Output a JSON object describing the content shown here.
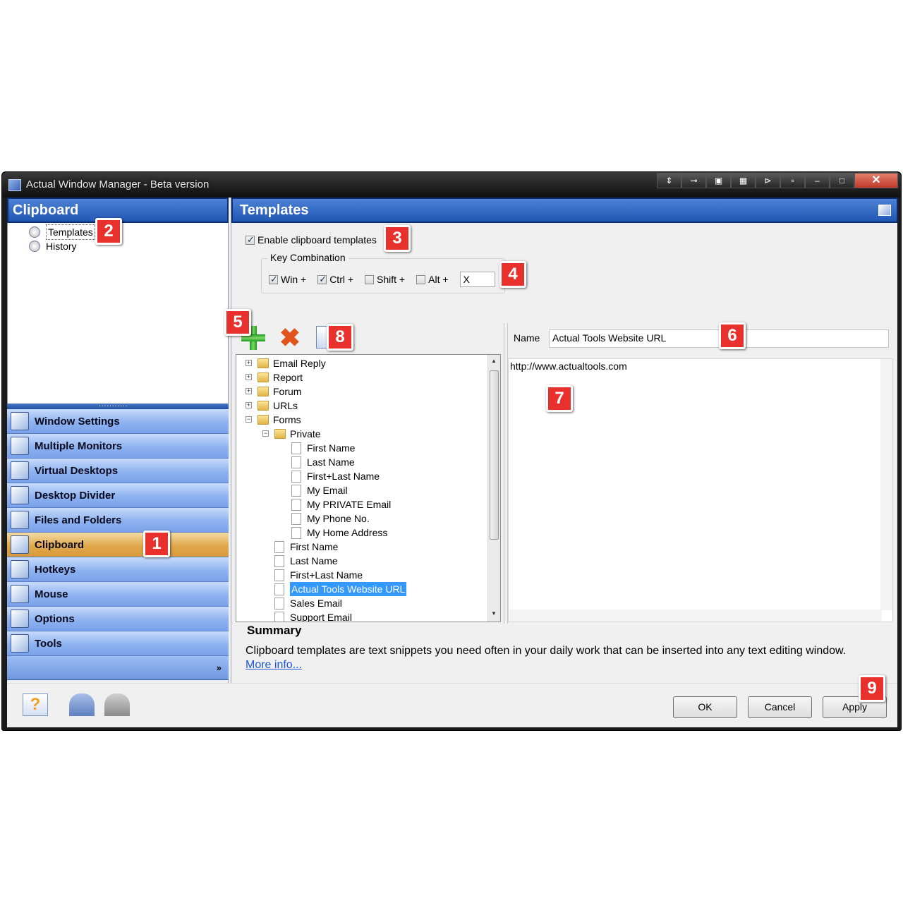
{
  "window": {
    "title": "Actual Window Manager - Beta version",
    "title_buttons": [
      "⇕",
      "⊸",
      "▣",
      "▦",
      "⊳",
      "▫",
      "–",
      "□",
      "✕"
    ]
  },
  "left": {
    "header": "Clipboard",
    "tree": [
      {
        "label": "Templates",
        "icon": "templates-icon"
      },
      {
        "label": "History",
        "icon": "history-clock-icon"
      }
    ],
    "grip": "...........",
    "nav": [
      {
        "label": "Window Settings",
        "icon": "window-settings-icon"
      },
      {
        "label": "Multiple Monitors",
        "icon": "multiple-monitors-icon"
      },
      {
        "label": "Virtual Desktops",
        "icon": "virtual-desktops-icon"
      },
      {
        "label": "Desktop Divider",
        "icon": "desktop-divider-icon"
      },
      {
        "label": "Files and Folders",
        "icon": "files-folders-icon"
      },
      {
        "label": "Clipboard",
        "icon": "clipboard-icon",
        "active": true
      },
      {
        "label": "Hotkeys",
        "icon": "keyboard-icon"
      },
      {
        "label": "Mouse",
        "icon": "mouse-icon"
      },
      {
        "label": "Options",
        "icon": "options-icon"
      },
      {
        "label": "Tools",
        "icon": "tools-icon"
      }
    ],
    "more": "»"
  },
  "right": {
    "header": "Templates",
    "enable_label": "Enable clipboard templates",
    "enable_checked": true,
    "key_group_label": "Key Combination",
    "keys": [
      {
        "label": "Win +",
        "checked": true
      },
      {
        "label": "Ctrl +",
        "checked": true
      },
      {
        "label": "Shift +",
        "checked": false
      },
      {
        "label": "Alt +",
        "checked": false
      }
    ],
    "key_value": "X",
    "name_label": "Name",
    "name_value": "Actual Tools Website URL",
    "content_value": "http://www.actualtools.com",
    "tree": [
      {
        "label": "Email Reply",
        "type": "folder",
        "level": 0,
        "expander": "+"
      },
      {
        "label": "Report",
        "type": "folder",
        "level": 0,
        "expander": "+"
      },
      {
        "label": "Forum",
        "type": "folder",
        "level": 0,
        "expander": "+"
      },
      {
        "label": "URLs",
        "type": "folder",
        "level": 0,
        "expander": "+"
      },
      {
        "label": "Forms",
        "type": "folder",
        "level": 0,
        "expander": "−"
      },
      {
        "label": "Private",
        "type": "folder",
        "level": 1,
        "expander": "−"
      },
      {
        "label": "First Name",
        "type": "doc",
        "level": 2
      },
      {
        "label": "Last Name",
        "type": "doc",
        "level": 2
      },
      {
        "label": "First+Last Name",
        "type": "doc",
        "level": 2
      },
      {
        "label": "My Email",
        "type": "doc",
        "level": 2
      },
      {
        "label": "My PRIVATE Email",
        "type": "doc",
        "level": 2
      },
      {
        "label": "My Phone No.",
        "type": "doc",
        "level": 2
      },
      {
        "label": "My Home Address",
        "type": "doc",
        "level": 2
      },
      {
        "label": "First Name",
        "type": "doc",
        "level": 1
      },
      {
        "label": "Last Name",
        "type": "doc",
        "level": 1
      },
      {
        "label": "First+Last Name",
        "type": "doc",
        "level": 1
      },
      {
        "label": "Actual Tools Website URL",
        "type": "doc",
        "level": 1,
        "selected": true
      },
      {
        "label": "Sales Email",
        "type": "doc",
        "level": 1
      },
      {
        "label": "Support Email",
        "type": "doc",
        "level": 1
      }
    ],
    "summary_title": "Summary",
    "summary_text": "Clipboard templates are text snippets you need often in your daily work that can be inserted into any text editing window.",
    "summary_link": "More info..."
  },
  "buttons": {
    "ok": "OK",
    "cancel": "Cancel",
    "apply": "Apply"
  },
  "badges": [
    "1",
    "2",
    "3",
    "4",
    "5",
    "6",
    "7",
    "8",
    "9"
  ],
  "colors": {
    "header_blue": "#2156b3",
    "nav_active": "#e0a84c",
    "selection": "#3399ff",
    "badge_red": "#e8302c"
  }
}
